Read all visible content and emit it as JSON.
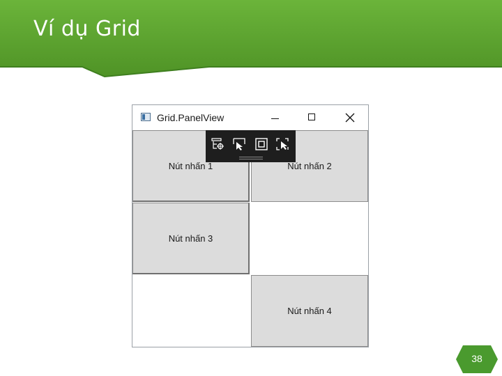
{
  "slide": {
    "title": "Ví dụ Grid",
    "page_number": "38",
    "colors": {
      "banner": "#5aa02c",
      "banner_dark": "#3f7f1f",
      "page_badge": "#4a9a2e"
    }
  },
  "window": {
    "title": "Grid.PanelView",
    "controls": [
      "minimize",
      "maximize",
      "close"
    ]
  },
  "grid": {
    "rows": 3,
    "columns": 2,
    "buttons": [
      {
        "label": "Nút nhấn 1",
        "row": 0,
        "column": 0
      },
      {
        "label": "Nút nhấn 2",
        "row": 0,
        "column": 1
      },
      {
        "label": "Nút nhấn 3",
        "row": 1,
        "column": 0
      },
      {
        "label": "Nút nhấn 4",
        "row": 2,
        "column": 1
      }
    ]
  },
  "debug_toolbar": {
    "icons": [
      "live-visual-tree-icon",
      "select-element-icon",
      "display-adorners-icon",
      "track-focus-icon"
    ]
  }
}
